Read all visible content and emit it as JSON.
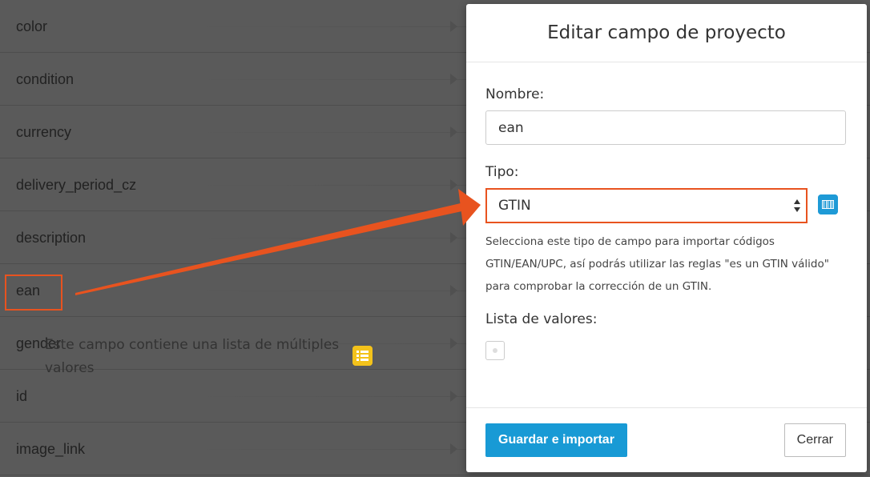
{
  "background_list": {
    "items": [
      "color",
      "condition",
      "currency",
      "delivery_period_cz",
      "description",
      "ean",
      "gender",
      "id",
      "image_link"
    ]
  },
  "modal": {
    "title": "Editar campo de proyecto",
    "name_label": "Nombre:",
    "name_value": "ean",
    "type_label": "Tipo:",
    "type_value": "GTIN",
    "help_text": "Selecciona este tipo de campo para importar códigos GTIN/EAN/UPC, así podrás utilizar las reglas \"es un GTIN válido\" para comprobar la corrección de un GTIN.",
    "list_label": "Lista de valores:",
    "checkbox_label": "Este campo contiene una lista de múltiples valores",
    "checkbox_checked": false,
    "save_button": "Guardar e importar",
    "close_button": "Cerrar"
  },
  "colors": {
    "accent_orange": "#e8531f",
    "primary_blue": "#189ad5",
    "list_icon_yellow": "#f3c21b"
  },
  "icons": {
    "type_icon": "barcode-icon",
    "list_icon": "list-icon"
  }
}
